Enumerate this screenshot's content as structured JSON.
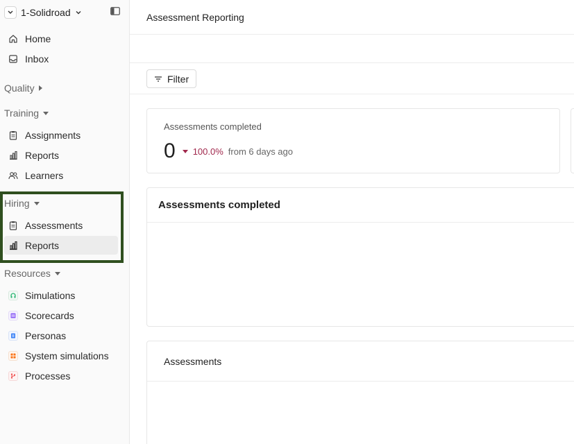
{
  "workspace": {
    "name": "1-Solidroad"
  },
  "sidebar": {
    "top_items": [
      {
        "label": "Home",
        "icon": "home-icon"
      },
      {
        "label": "Inbox",
        "icon": "inbox-icon"
      }
    ],
    "sections": {
      "quality": {
        "label": "Quality"
      },
      "training": {
        "label": "Training",
        "items": [
          "Assignments",
          "Reports",
          "Learners"
        ]
      },
      "hiring": {
        "label": "Hiring",
        "items": [
          "Assessments",
          "Reports"
        ]
      },
      "resources": {
        "label": "Resources",
        "items": [
          "Simulations",
          "Scorecards",
          "Personas",
          "System simulations",
          "Processes"
        ]
      }
    },
    "active_item": "Hiring / Reports"
  },
  "header": {
    "title": "Assessment Reporting"
  },
  "filter": {
    "label": "Filter"
  },
  "stat": {
    "label": "Assessments completed",
    "value": "0",
    "delta": "100.0%",
    "comparison": "from 6 days ago",
    "delta_color": "#a0284c"
  },
  "chart_card": {
    "title": "Assessments completed"
  },
  "table_card": {
    "title": "Assessments"
  },
  "colors": {
    "highlight_border": "#2f4f1f",
    "simulations_icon": "#2bb673",
    "scorecards_icon": "#8b5cf6",
    "personas_icon": "#3b82f6",
    "system_simulations_icon": "#f97316",
    "processes_icon": "#ef4444"
  }
}
